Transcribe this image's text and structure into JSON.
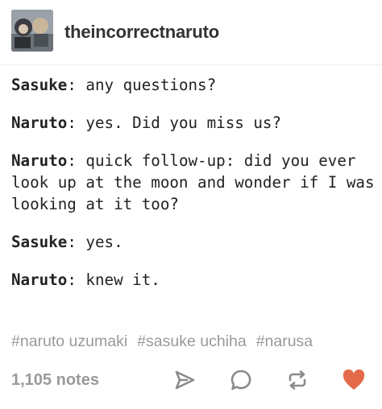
{
  "post": {
    "blog_name": "theincorrectnaruto",
    "dialogue": [
      {
        "speaker": "Sasuke",
        "text": "any questions?"
      },
      {
        "speaker": "Naruto",
        "text": "yes. Did you miss us?"
      },
      {
        "speaker": "Naruto",
        "text": "quick follow-up: did you ever look up at the moon and wonder if I was looking at it too?"
      },
      {
        "speaker": "Sasuke",
        "text": "yes."
      },
      {
        "speaker": "Naruto",
        "text": "knew it."
      }
    ],
    "tags": [
      "#naruto uzumaki",
      "#sasuke uchiha",
      "#narusa"
    ],
    "notes": "1,105 notes"
  },
  "icons": {
    "share": "paper-plane-icon",
    "reply": "speech-bubble-icon",
    "reblog": "reblog-icon",
    "like": "heart-icon"
  },
  "colors": {
    "like": "#e46a4a",
    "icon_gray": "#8a8a8a",
    "tag_gray": "#999999"
  }
}
